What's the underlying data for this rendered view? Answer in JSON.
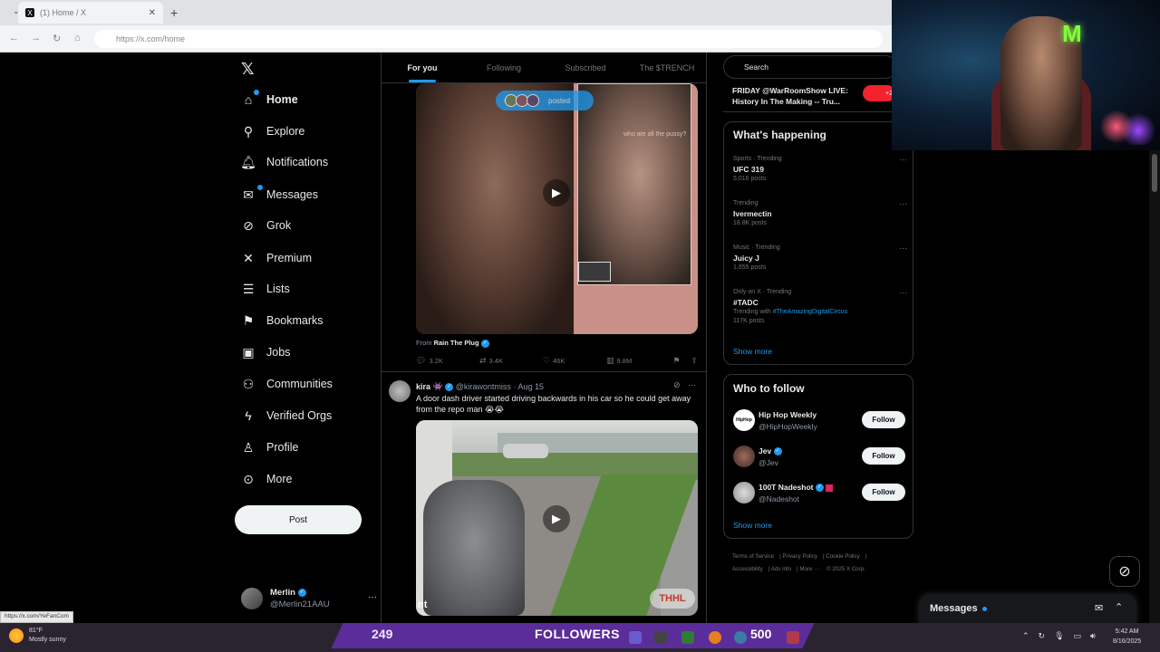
{
  "browser": {
    "tab_title": "(1) Home / X",
    "tab_close": "✕",
    "new_tab": "+",
    "url": "https://x.com/home",
    "status_link": "https://x.com/YeFanCom"
  },
  "sidebar": {
    "logo": "𝕏",
    "items": [
      {
        "label": "Home",
        "icon": "home-icon",
        "glyph": "⌂"
      },
      {
        "label": "Explore",
        "icon": "search-icon",
        "glyph": "⚲"
      },
      {
        "label": "Notifications",
        "icon": "bell-icon",
        "glyph": "🔔︎"
      },
      {
        "label": "Messages",
        "icon": "envelope-icon",
        "glyph": "✉"
      },
      {
        "label": "Grok",
        "icon": "grok-icon",
        "glyph": "⊘"
      },
      {
        "label": "Premium",
        "icon": "x-premium-icon",
        "glyph": "✕"
      },
      {
        "label": "Lists",
        "icon": "list-icon",
        "glyph": "☰"
      },
      {
        "label": "Bookmarks",
        "icon": "bookmark-icon",
        "glyph": "⚑"
      },
      {
        "label": "Jobs",
        "icon": "briefcase-icon",
        "glyph": "▣"
      },
      {
        "label": "Communities",
        "icon": "people-icon",
        "glyph": "⚇"
      },
      {
        "label": "Verified Orgs",
        "icon": "lightning-icon",
        "glyph": "ϟ"
      },
      {
        "label": "Profile",
        "icon": "person-icon",
        "glyph": "♙"
      },
      {
        "label": "More",
        "icon": "more-circle-icon",
        "glyph": "⊙"
      }
    ],
    "post_label": "Post",
    "account": {
      "name": "Merlin",
      "handle": "@Merlin21AAU",
      "more": "···"
    }
  },
  "topnav": {
    "tabs": [
      "For you",
      "Following",
      "Subscribed",
      "The $TRENCH"
    ]
  },
  "feed": {
    "post1": {
      "posted_label": "posted",
      "overlay_caption": "who ate all the pussy?",
      "from_prefix": "From",
      "from_source": "Rain The Plug",
      "replies": "3.2K",
      "reposts": "3.4K",
      "likes": "46K",
      "views": "9.8M"
    },
    "post2": {
      "name": "kira 👾",
      "handle": "@kirawontmiss",
      "date": "· Aug 15",
      "text": "A door dash driver started driving backwards in his car so he could get away from the repo man 😭😭",
      "media_logo": "THHL",
      "media_corner": "nt"
    }
  },
  "right": {
    "search_placeholder": "Search",
    "live": {
      "text": "FRIDAY @WarRoomShow LIVE: History In The Making -- Tru...",
      "extra": "+2"
    },
    "happening": {
      "title": "What's happening",
      "trends": [
        {
          "category": "Sports · Trending",
          "name": "UFC 319",
          "count": "5,016 posts"
        },
        {
          "category": "Trending",
          "name": "Ivermectin",
          "count": "18.8K posts"
        },
        {
          "category": "Music · Trending",
          "name": "Juicy J",
          "count": "1,655 posts"
        },
        {
          "category": "Only on X · Trending",
          "name": "#TADC",
          "with_prefix": "Trending with ",
          "with_tag": "#TheAmazingDigitalCircus",
          "count": "117K posts"
        }
      ],
      "show_more": "Show more"
    },
    "who_to_follow": {
      "title": "Who to follow",
      "accounts": [
        {
          "name": "Hip Hop Weekly",
          "handle": "@HipHopWeekly",
          "button": "Follow"
        },
        {
          "name": "Jev",
          "handle": "@Jev",
          "button": "Follow"
        },
        {
          "name": "100T Nadeshot",
          "handle": "@Nadeshot",
          "button": "Follow"
        }
      ],
      "show_more": "Show more"
    },
    "footer": [
      "Terms of Service",
      "Privacy Policy",
      "Cookie Policy",
      "Accessibility",
      "Ads info",
      "More ···",
      "© 2025 X Corp."
    ]
  },
  "messages_drawer": {
    "title": "Messages"
  },
  "taskbar": {
    "temperature": "81°F",
    "weather": "Mostly sunny",
    "followers_count": "249",
    "followers_label": "FOLLOWERS",
    "followers_goal": "500",
    "time": "5:42 AM",
    "date": "8/16/2025"
  },
  "colors": {
    "accent": "#1d9bf0",
    "background": "#000000",
    "banner": "#5b2d9a"
  }
}
